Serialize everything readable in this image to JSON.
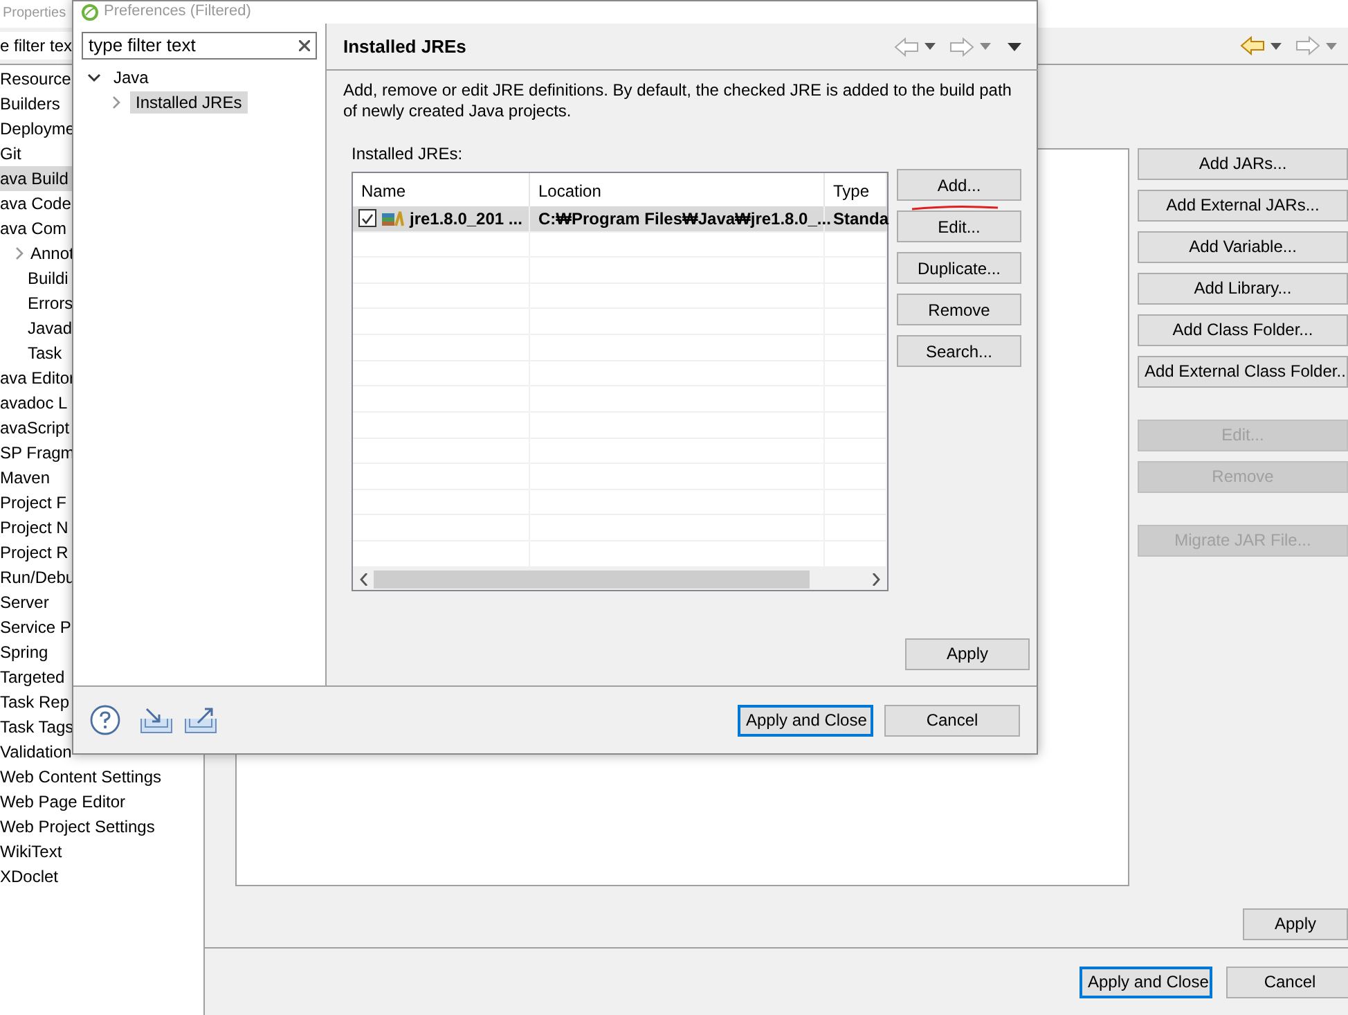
{
  "background_window": {
    "title": "Properties",
    "filter": {
      "placeholder": "e filter tex"
    },
    "tree": [
      {
        "label": "Resource",
        "selected": false
      },
      {
        "label": "Builders",
        "selected": false
      },
      {
        "label": "Deployme",
        "selected": false
      },
      {
        "label": "Git",
        "selected": false
      },
      {
        "label": "ava Build",
        "selected": true
      },
      {
        "label": "ava Code",
        "selected": false
      },
      {
        "label": "ava Com",
        "selected": false,
        "children": [
          {
            "label": "Annot",
            "selected": false,
            "expanded": false
          },
          {
            "label": "Buildi",
            "selected": false
          },
          {
            "label": "Errors",
            "selected": false
          },
          {
            "label": "Javad",
            "selected": false
          },
          {
            "label": "Task",
            "selected": false
          }
        ]
      },
      {
        "label": "ava Editor",
        "selected": false
      },
      {
        "label": "avadoc L",
        "selected": false
      },
      {
        "label": "avaScript",
        "selected": false
      },
      {
        "label": "SP Fragm",
        "selected": false
      },
      {
        "label": "Maven",
        "selected": false
      },
      {
        "label": "Project F",
        "selected": false
      },
      {
        "label": "Project N",
        "selected": false
      },
      {
        "label": "Project R",
        "selected": false
      },
      {
        "label": "Run/Debu",
        "selected": false
      },
      {
        "label": "Server",
        "selected": false
      },
      {
        "label": "Service P",
        "selected": false
      },
      {
        "label": "Spring",
        "selected": false
      },
      {
        "label": "Targeted",
        "selected": false
      },
      {
        "label": "Task Rep",
        "selected": false
      },
      {
        "label": "Task Tags",
        "selected": false
      },
      {
        "label": "Validation",
        "selected": false
      },
      {
        "label": "Web Content Settings",
        "selected": false
      },
      {
        "label": "Web Page Editor",
        "selected": false
      },
      {
        "label": "Web Project Settings",
        "selected": false
      },
      {
        "label": "WikiText",
        "selected": false
      },
      {
        "label": "XDoclet",
        "selected": false
      }
    ],
    "buttons": [
      {
        "label": "Add JARs...",
        "disabled": false
      },
      {
        "label": "Add External JARs...",
        "disabled": false
      },
      {
        "label": "Add Variable...",
        "disabled": false
      },
      {
        "label": "Add Library...",
        "disabled": false
      },
      {
        "label": "Add Class Folder...",
        "disabled": false
      },
      {
        "label": "Add External Class Folder..",
        "disabled": false
      },
      {
        "label": "Edit...",
        "disabled": true
      },
      {
        "label": "Remove",
        "disabled": true
      },
      {
        "label": "Migrate JAR File...",
        "disabled": true
      }
    ],
    "apply": "Apply",
    "footer_buttons": [
      {
        "label": "Apply and Close",
        "default": true
      },
      {
        "label": "Cancel",
        "default": false
      }
    ]
  },
  "dialog": {
    "title": "Preferences (Filtered)",
    "filter": {
      "placeholder": "type filter text"
    },
    "tree": [
      {
        "label": "Java",
        "expanded": true,
        "selected": false,
        "children": [
          {
            "label": "Installed JREs",
            "expanded": false,
            "selected": true
          }
        ]
      }
    ],
    "page_title": "Installed JREs",
    "description": "Add, remove or edit JRE definitions. By default, the checked JRE is added to the build path of newly created Java projects.",
    "table_label": "Installed JREs:",
    "table": {
      "columns": [
        "Name",
        "Location",
        "Type"
      ],
      "rows": [
        {
          "checked": true,
          "selected": true,
          "cells": [
            "jre1.8.0_201 ...",
            "C:₩Program Files₩Java₩jre1.8.0_...",
            "Standa"
          ]
        }
      ]
    },
    "side_buttons": [
      "Add...",
      "Edit...",
      "Duplicate...",
      "Remove",
      "Search..."
    ],
    "apply": "Apply",
    "footer_buttons": [
      {
        "label": "Apply and Close",
        "default": true
      },
      {
        "label": "Cancel",
        "default": false
      }
    ]
  }
}
